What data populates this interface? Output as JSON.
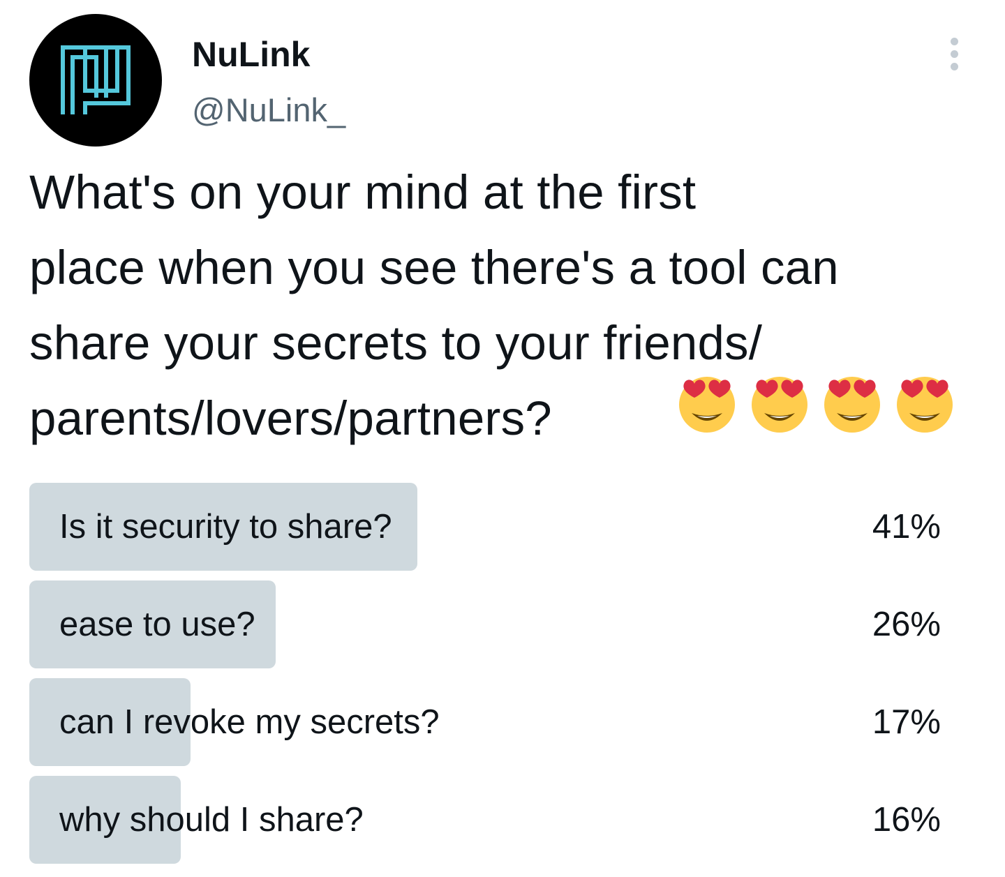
{
  "author": {
    "display_name": "NuLink",
    "handle": "@NuLink_",
    "avatar_icon": "nulink-logo-icon"
  },
  "more_icon": "more-options-icon",
  "tweet": {
    "text": "What's on your mind at the first\nplace when you see there's a tool can\nshare your secrets to your friends/\nparents/lovers/partners?",
    "emojis": [
      "😍",
      "😍",
      "😍",
      "😍"
    ]
  },
  "poll": {
    "bar_color": "#cfd9de",
    "options": [
      {
        "label": "Is it security to share?",
        "percent": "41%",
        "share": 0.41
      },
      {
        "label": "ease to use?",
        "percent": "26%",
        "share": 0.26
      },
      {
        "label": "can I revoke my secrets?",
        "percent": "17%",
        "share": 0.17
      },
      {
        "label": "why should I share?",
        "percent": "16%",
        "share": 0.16
      }
    ]
  }
}
